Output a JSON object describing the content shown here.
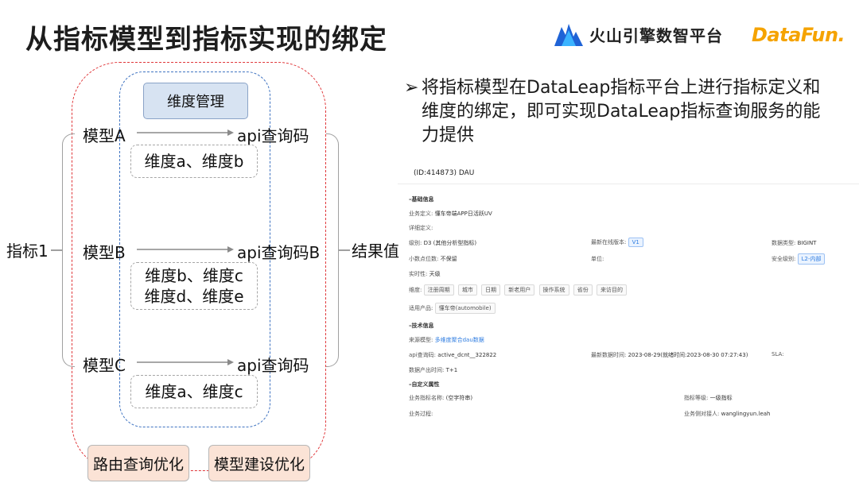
{
  "title": "从指标模型到指标实现的绑定",
  "logos": {
    "volcano_text": "火山引擎数智平台",
    "datafun_text": "DataFun."
  },
  "diagram": {
    "dim_mgmt": "维度管理",
    "metric": "指标1",
    "result": "结果值",
    "models": [
      {
        "label": "模型A",
        "api": "api查询码",
        "dims": [
          "维度a、维度b"
        ]
      },
      {
        "label": "模型B",
        "api": "api查询码B",
        "dims": [
          "维度b、维度c",
          "维度d、维度e"
        ]
      },
      {
        "label": "模型C",
        "api": "api查询码",
        "dims": [
          "维度a、维度c"
        ]
      }
    ],
    "route_opt": "路由查询优化",
    "model_opt": "模型建设优化"
  },
  "bullet": {
    "arrow": "➢",
    "text": "将指标模型在DataLeap指标平台上进行指标定义和维度的绑定，即可实现DataLeap指标查询服务的能力提供"
  },
  "panel": {
    "header": "(ID:414873)  DAU",
    "basic_section": "–基础信息",
    "biz_def_label": "业务定义:",
    "biz_def_value": "懂车帝端APP日活跃UV",
    "detail_label": "详细定义:",
    "level_label": "级别:",
    "level_value": "D3 (其他分析型指标)",
    "latest_version_label": "最新在线版本:",
    "latest_version_value": "V1",
    "data_type_label": "数据类型:",
    "data_type_value": "BIGINT",
    "decimal_label": "小数点位数:",
    "decimal_value": "不保留",
    "unit_label": "单位:",
    "security_label": "安全级别:",
    "security_value": "L2-内部",
    "realtime_label": "实时性:",
    "realtime_value": "天级",
    "dimension_label": "维度:",
    "dimensions": [
      "注册周期",
      "城市",
      "日期",
      "新老用户",
      "操作系统",
      "省份",
      "来访目的"
    ],
    "product_label": "适用产品:",
    "product_value": "懂车帝(automobile)",
    "tech_section": "–技术信息",
    "source_model_label": "来源模型:",
    "source_model_value": "多维度聚合dau数据",
    "api_code_label": "api查询码:",
    "api_code_value": "active_dcnt__322822",
    "latest_data_label": "最新数据时间:",
    "latest_data_value": "2023-08-29(就绪时间:2023-08-30 07:27:43)",
    "sla_label": "SLA:",
    "output_time_label": "数据产出时间:",
    "output_time_value": "T+1",
    "custom_section": "–自定义属性",
    "biz_name_label": "业务指标名称:",
    "biz_name_value": "(空字符串)",
    "metric_level_label": "指标等级:",
    "metric_level_value": "一级指标",
    "biz_process_label": "业务过程:",
    "contact_label": "业务侧对接人:",
    "contact_value": "wanglingyun.leah"
  },
  "colors": {
    "outer_dashed": "#e0373a",
    "inner_dashed": "#3f73c1",
    "dim_mgmt_fill": "#d7e3f2",
    "opt_fill": "#fbe3d6",
    "datafun": "#f5a300"
  }
}
